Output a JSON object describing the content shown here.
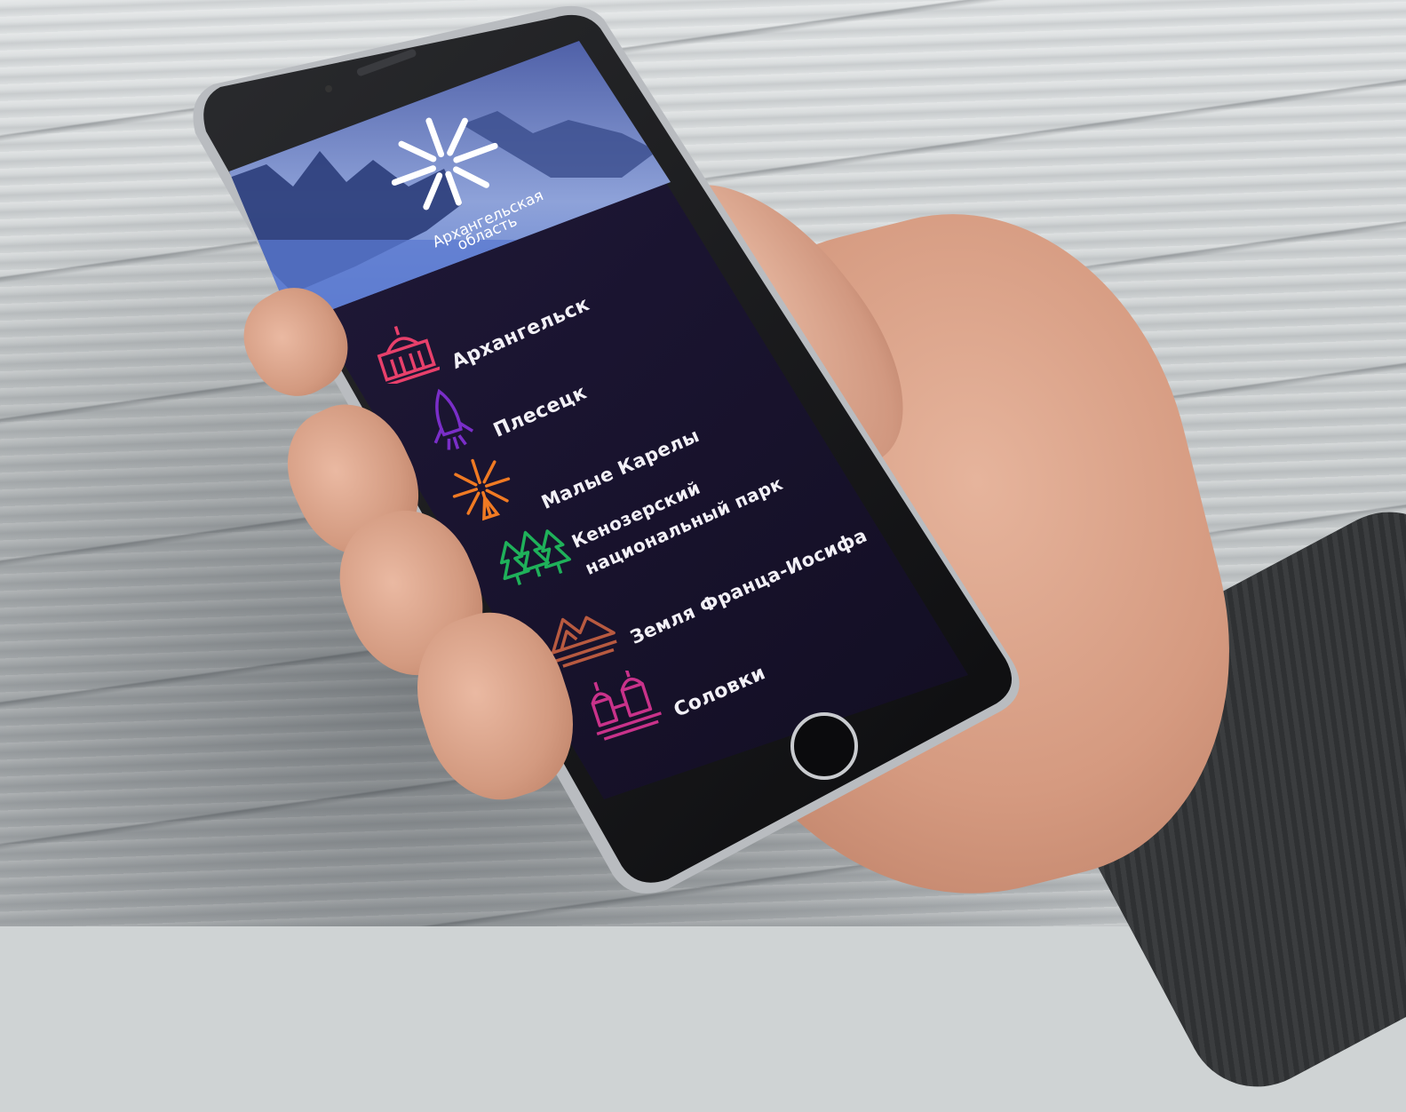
{
  "header": {
    "brand_line1": "Архангельская",
    "brand_line2": "область",
    "brand_tagline": "",
    "logo_icon": "sun-burst-icon"
  },
  "menu": {
    "items": [
      {
        "label": "Архангельск",
        "icon": "church-icon",
        "color": "#e8406b"
      },
      {
        "label": "Плесецк",
        "icon": "rocket-icon",
        "color": "#7a2ec8"
      },
      {
        "label": "Малые Карелы",
        "icon": "sunburst-windmill-icon",
        "color": "#f07a23"
      },
      {
        "label_line1": "Кенозерский",
        "label_line2": "национальный парк",
        "icon": "pine-trees-icon",
        "color": "#1fb15a"
      },
      {
        "label": "Земля Франца-Иосифа",
        "icon": "mountains-icon",
        "color": "#b85a40"
      },
      {
        "label": "Соловки",
        "icon": "monastery-icon",
        "color": "#c9328a"
      }
    ]
  },
  "colors": {
    "screen_bg": "#17122a",
    "header_sky": "#6d86c9"
  }
}
